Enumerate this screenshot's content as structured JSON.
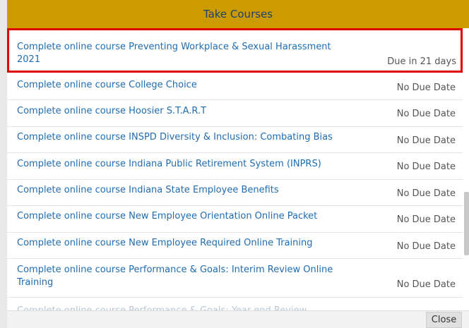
{
  "dialog": {
    "title": "Take Courses",
    "close_label": "Close"
  },
  "courses": [
    {
      "title": "Complete online course Preventing Workplace & Sexual Harassment 2021",
      "due": "Due in 21 days",
      "highlighted": true
    },
    {
      "title": "Complete online course College Choice",
      "due": "No Due Date"
    },
    {
      "title": "Complete online course Hoosier S.T.A.R.T",
      "due": "No Due Date"
    },
    {
      "title": "Complete online course INSPD Diversity & Inclusion: Combating Bias",
      "due": "No Due Date"
    },
    {
      "title": "Complete online course Indiana Public Retirement System (INPRS)",
      "due": "No Due Date"
    },
    {
      "title": "Complete online course Indiana State Employee Benefits",
      "due": "No Due Date"
    },
    {
      "title": "Complete online course New Employee Orientation Online Packet",
      "due": "No Due Date"
    },
    {
      "title": "Complete online course New Employee Required Online Training",
      "due": "No Due Date"
    },
    {
      "title": "Complete online course Performance & Goals: Interim Review Online Training",
      "due": "No Due Date"
    }
  ],
  "partial_row_text": "Complete online course Performance & Goals: Year-end Review",
  "colors": {
    "header_bg": "#cc9b00",
    "header_text": "#1f3f73",
    "link": "#1f6cb0",
    "highlight_border": "#e00000"
  }
}
